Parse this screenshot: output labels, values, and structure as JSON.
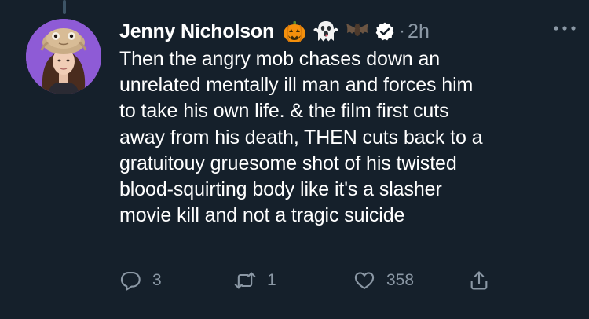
{
  "tweet": {
    "author": {
      "display_name": "Jenny Nicholson",
      "emoji_icons": [
        "jack-o-lantern-icon",
        "ghost-icon",
        "bat-icon"
      ],
      "verified": true
    },
    "separator": "·",
    "timestamp": "2h",
    "text_lines": [
      "Then the angry mob chases down an",
      "unrelated mentally ill man and forces him",
      "to take his own life. & the film first cuts",
      "away from his death, THEN cuts back to a",
      "gratuitouy gruesome shot of his twisted",
      "blood-squirting body like it's a slasher",
      "movie kill and not a tragic suicide"
    ],
    "actions": {
      "reply_count": "3",
      "retweet_count": "1",
      "like_count": "358"
    }
  },
  "colors": {
    "background": "#15202b",
    "text": "#ffffff",
    "muted": "#8b98a5",
    "thread_line": "#3d5466",
    "avatar_bg": "#8e5bd6"
  }
}
